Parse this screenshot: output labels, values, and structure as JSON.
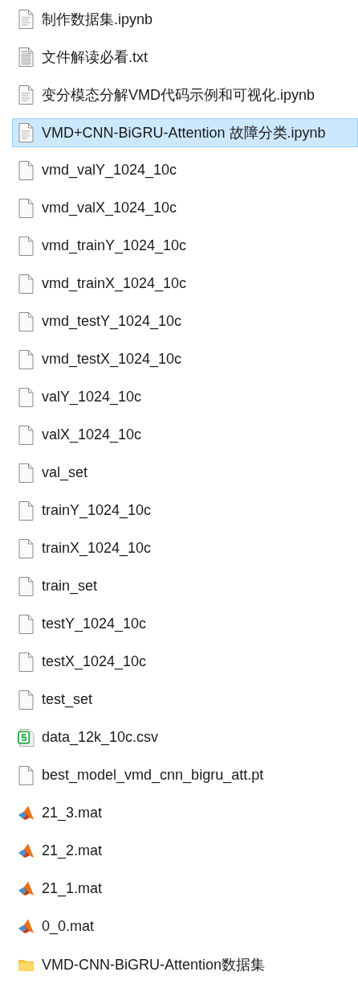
{
  "files": [
    {
      "name": "制作数据集.ipynb",
      "kind": "notebook",
      "selected": false
    },
    {
      "name": "文件解读必看.txt",
      "kind": "text",
      "selected": false
    },
    {
      "name": "变分模态分解VMD代码示例和可视化.ipynb",
      "kind": "notebook",
      "selected": false
    },
    {
      "name": "VMD+CNN-BiGRU-Attention 故障分类.ipynb",
      "kind": "notebook",
      "selected": true
    },
    {
      "name": "vmd_valY_1024_10c",
      "kind": "blank",
      "selected": false
    },
    {
      "name": "vmd_valX_1024_10c",
      "kind": "blank",
      "selected": false
    },
    {
      "name": "vmd_trainY_1024_10c",
      "kind": "blank",
      "selected": false
    },
    {
      "name": "vmd_trainX_1024_10c",
      "kind": "blank",
      "selected": false
    },
    {
      "name": "vmd_testY_1024_10c",
      "kind": "blank",
      "selected": false
    },
    {
      "name": "vmd_testX_1024_10c",
      "kind": "blank",
      "selected": false
    },
    {
      "name": "valY_1024_10c",
      "kind": "blank",
      "selected": false
    },
    {
      "name": "valX_1024_10c",
      "kind": "blank",
      "selected": false
    },
    {
      "name": "val_set",
      "kind": "blank",
      "selected": false
    },
    {
      "name": "trainY_1024_10c",
      "kind": "blank",
      "selected": false
    },
    {
      "name": "trainX_1024_10c",
      "kind": "blank",
      "selected": false
    },
    {
      "name": "train_set",
      "kind": "blank",
      "selected": false
    },
    {
      "name": "testY_1024_10c",
      "kind": "blank",
      "selected": false
    },
    {
      "name": "testX_1024_10c",
      "kind": "blank",
      "selected": false
    },
    {
      "name": "test_set",
      "kind": "blank",
      "selected": false
    },
    {
      "name": "data_12k_10c.csv",
      "kind": "spreadsheet",
      "selected": false
    },
    {
      "name": "best_model_vmd_cnn_bigru_att.pt",
      "kind": "blank",
      "selected": false
    },
    {
      "name": "21_3.mat",
      "kind": "matlab",
      "selected": false
    },
    {
      "name": "21_2.mat",
      "kind": "matlab",
      "selected": false
    },
    {
      "name": "21_1.mat",
      "kind": "matlab",
      "selected": false
    },
    {
      "name": "0_0.mat",
      "kind": "matlab",
      "selected": false
    },
    {
      "name": "VMD-CNN-BiGRU-Attention数据集",
      "kind": "folder",
      "selected": false
    }
  ]
}
